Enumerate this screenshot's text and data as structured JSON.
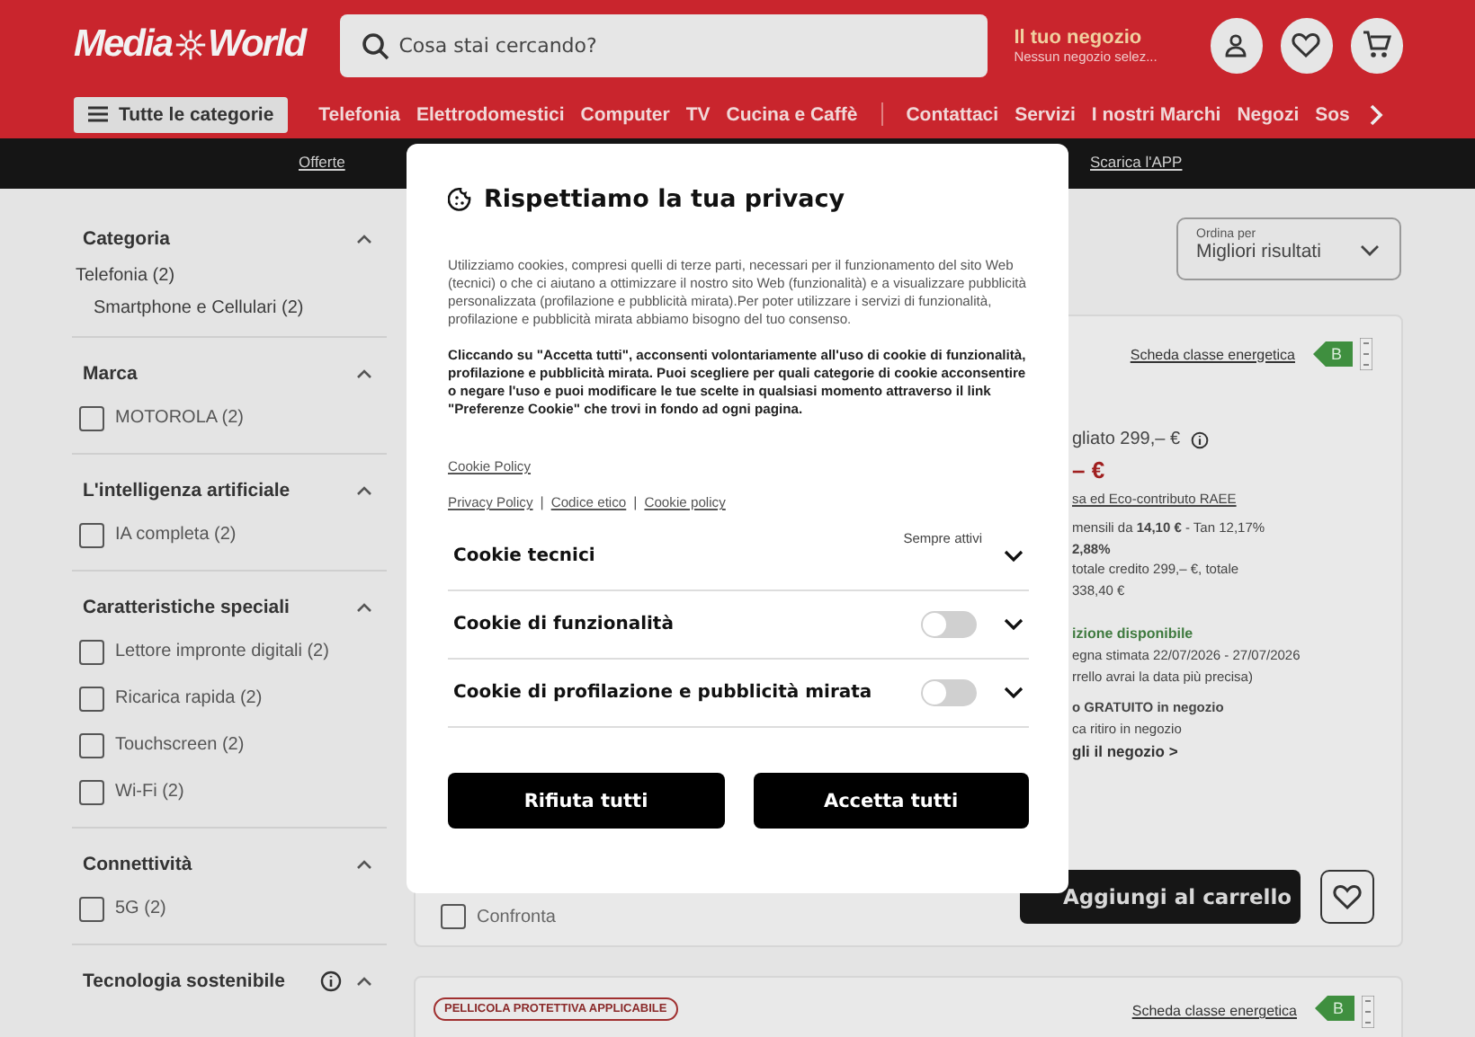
{
  "header": {
    "logo": [
      "Media",
      "World"
    ],
    "search": {
      "placeholder": "Cosa stai cercando?"
    },
    "store": {
      "title": "Il tuo negozio",
      "subtitle": "Nessun negozio selez..."
    },
    "categories_button": "Tutte le categorie",
    "nav_primary": [
      "Telefonia",
      "Elettrodomestici",
      "Computer",
      "TV",
      "Cucina e Caffè"
    ],
    "nav_secondary": [
      "Contattaci",
      "Servizi",
      "I nostri Marchi",
      "Negozi",
      "Sos"
    ]
  },
  "promo_bar": [
    "Offerte",
    "Scarica l'APP"
  ],
  "filters": [
    {
      "title": "Categoria",
      "expanded": true,
      "items": [
        {
          "kind": "link",
          "label": "Telefonia (2)",
          "children": [
            {
              "label": "Smartphone e Cellulari (2)"
            }
          ]
        }
      ]
    },
    {
      "title": "Marca",
      "expanded": true,
      "items": [
        {
          "kind": "checkbox",
          "label": "MOTOROLA (2)",
          "checked": false
        }
      ]
    },
    {
      "title": "L'intelligenza artificiale",
      "expanded": true,
      "items": [
        {
          "kind": "checkbox",
          "label": "IA completa (2)",
          "checked": false
        }
      ]
    },
    {
      "title": "Caratteristiche speciali",
      "expanded": true,
      "items": [
        {
          "kind": "checkbox",
          "label": "Lettore impronte digitali (2)",
          "checked": false
        },
        {
          "kind": "checkbox",
          "label": "Ricarica rapida (2)",
          "checked": false
        },
        {
          "kind": "checkbox",
          "label": "Touchscreen (2)",
          "checked": false
        },
        {
          "kind": "checkbox",
          "label": "Wi-Fi (2)",
          "checked": false
        }
      ]
    },
    {
      "title": "Connettività",
      "expanded": true,
      "items": [
        {
          "kind": "checkbox",
          "label": "5G (2)",
          "checked": false
        }
      ]
    },
    {
      "title": "Tecnologia sostenibile",
      "expanded": true,
      "info": true
    }
  ],
  "sort": {
    "label": "Ordina per",
    "value": "Migliori risultati"
  },
  "products": [
    {
      "energy_link": "Scheda classe energetica",
      "energy_class": "B",
      "details": [
        {
          "kind": "text",
          "text": "gliato 299,– €",
          "info": true
        },
        {
          "kind": "price",
          "text": "– €"
        },
        {
          "kind": "link",
          "text": "sa ed Eco-contributo RAEE"
        },
        {
          "kind": "small",
          "text": "mensili da **14,10 €** - Tan 12,17%"
        },
        {
          "kind": "small-bold",
          "text": "2,88%"
        },
        {
          "kind": "small",
          "text": "totale credito 299,– €, totale"
        },
        {
          "kind": "small",
          "text": "338,40 €"
        },
        {
          "kind": "green",
          "text": "izione disponibile"
        },
        {
          "kind": "small",
          "text": "egna stimata 22/07/2026 - 27/07/2026"
        },
        {
          "kind": "small",
          "text": "rrello avrai la data più precisa)"
        },
        {
          "kind": "small-bold",
          "text": "o GRATUITO in negozio"
        },
        {
          "kind": "small",
          "text": "ca ritiro in negozio"
        },
        {
          "kind": "bold",
          "text": "gli il negozio >"
        }
      ],
      "compare": {
        "label": "Confronta",
        "checked": false
      },
      "add_to_cart": "Aggiungi al carrello"
    },
    {
      "badge": "PELLICOLA PROTETTIVA APPLICABILE",
      "energy_link": "Scheda classe energetica",
      "energy_class": "B"
    }
  ],
  "cookie_dialog": {
    "title": "Rispettiamo la tua privacy",
    "intro": "Utilizziamo cookies, compresi quelli di terze parti, necessari per il funzionamento del sito Web (tecnici) o che ci aiutano a ottimizzare il nostro sito Web (funzionalità) e a visualizzare pubblicità personalizzata (profilazione e pubblicità mirata).Per poter utilizzare i servizi di funzionalità, profilazione e pubblicità mirata abbiamo bisogno del tuo consenso.",
    "notice": "Cliccando su \"Accetta tutti\", acconsenti volontariamente all'uso di cookie di funzionalità, profilazione e pubblicità mirata. Puoi scegliere per quali categorie di cookie acconsentire o negare l'uso e puoi modificare le tue scelte in qualsiasi momento attraverso il link \"Preferenze Cookie\" che trovi in fondo ad ogni pagina.",
    "policy_link": "Cookie Policy",
    "links": [
      "Privacy Policy",
      "Codice etico",
      "Cookie policy"
    ],
    "link_separator": "|",
    "categories": [
      {
        "kind": "always",
        "label": "Cookie tecnici",
        "status": "Sempre attivi",
        "expanded": false
      },
      {
        "kind": "toggle",
        "label": "Cookie di funzionalità",
        "on": false,
        "expanded": false
      },
      {
        "kind": "toggle",
        "label": "Cookie di profilazione e pubblicità mirata",
        "on": false,
        "expanded": false
      }
    ],
    "buttons": [
      "Rifiuta tutti",
      "Accetta tutti"
    ]
  }
}
